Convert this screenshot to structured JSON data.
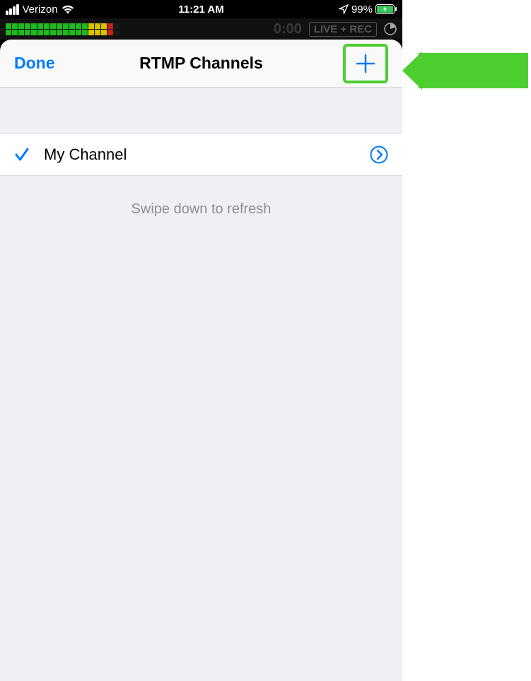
{
  "status": {
    "carrier": "Verizon",
    "time": "11:21 AM",
    "battery": "99%"
  },
  "rec": {
    "time": "0:00",
    "badge": "LIVE + REC"
  },
  "nav": {
    "done": "Done",
    "title": "RTMP Channels"
  },
  "list": {
    "items": [
      {
        "label": "My Channel",
        "checked": true
      }
    ],
    "refresh_hint": "Swipe down to refresh"
  },
  "colors": {
    "accent_blue": "#007aff",
    "callout_green": "#4cce2f",
    "battery_green": "#35c759"
  },
  "meter": {
    "green_cols": 13,
    "yellow_cols": 3,
    "red_cols": 1
  }
}
